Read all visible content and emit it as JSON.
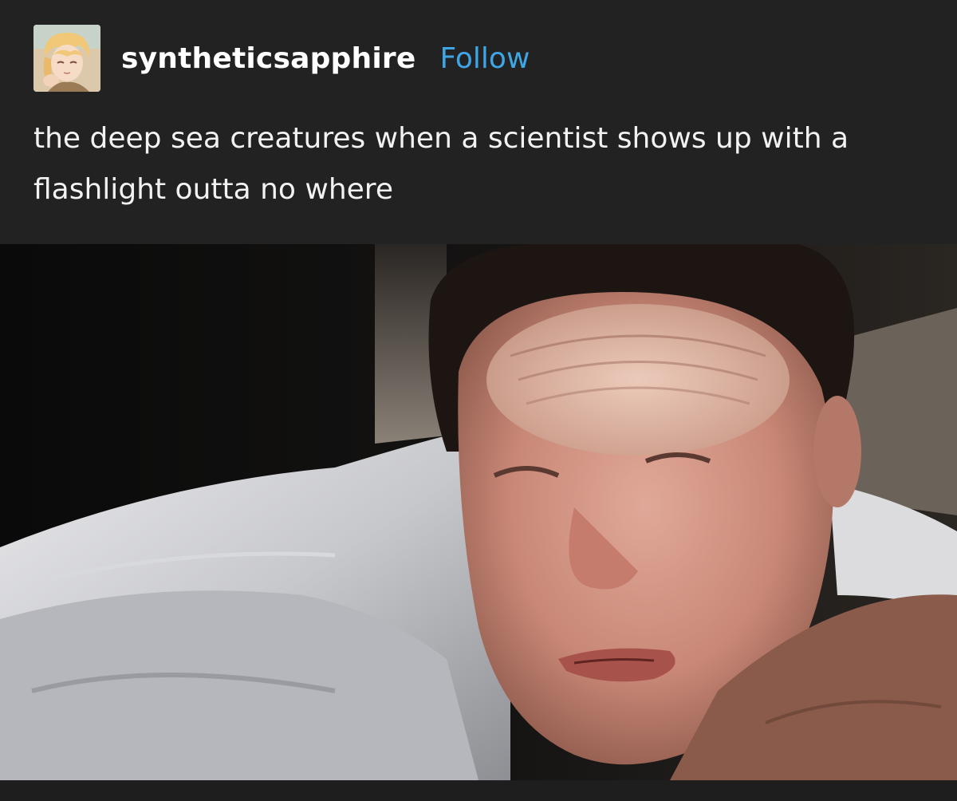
{
  "post": {
    "username": "syntheticsapphire",
    "follow_label": "Follow",
    "caption": "the deep sea creatures when a scientist shows up with a flashlight outta no where"
  },
  "colors": {
    "background": "#222222",
    "follow_link": "#3fa6e6",
    "text": "#f2f2f2"
  },
  "icons": {
    "avatar": "user-avatar-anime-portrait"
  }
}
